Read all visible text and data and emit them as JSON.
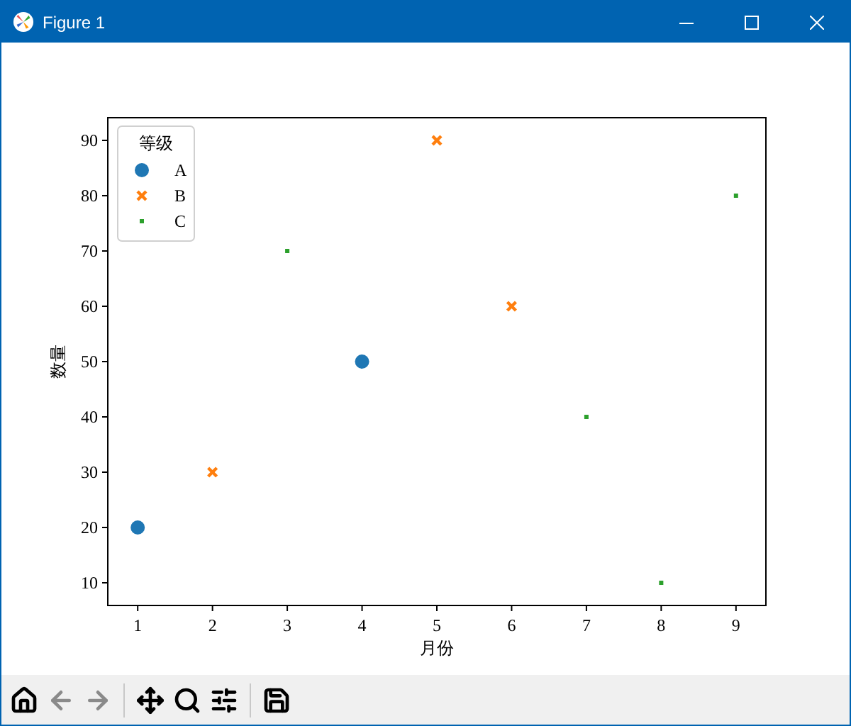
{
  "window": {
    "title": "Figure 1"
  },
  "figure": {
    "chart_data": {
      "type": "scatter",
      "legend": {
        "title": "等级"
      },
      "xlabel": "月份",
      "ylabel": "数量",
      "x": [
        1,
        2,
        3,
        4,
        5,
        6,
        7,
        8,
        9
      ],
      "series": [
        {
          "name": "A",
          "color": "#1f77b4",
          "marker": "circle",
          "values": [
            20,
            null,
            null,
            50,
            null,
            null,
            null,
            null,
            null
          ]
        },
        {
          "name": "B",
          "color": "#ff7f0e",
          "marker": "x",
          "values": [
            null,
            30,
            null,
            null,
            90,
            60,
            null,
            null,
            null
          ]
        },
        {
          "name": "C",
          "color": "#2ca02c",
          "marker": "square",
          "values": [
            null,
            null,
            70,
            null,
            null,
            null,
            40,
            10,
            80
          ]
        }
      ],
      "xlim": [
        0.6,
        9.4
      ],
      "ylim": [
        5.9,
        94.1
      ],
      "xticks": [
        1,
        2,
        3,
        4,
        5,
        6,
        7,
        8,
        9
      ],
      "yticks": [
        10,
        20,
        30,
        40,
        50,
        60,
        70,
        80,
        90
      ]
    }
  },
  "toolbar": {
    "buttons": [
      {
        "kind": "home",
        "disabled": false
      },
      {
        "kind": "back",
        "disabled": true
      },
      {
        "kind": "forward",
        "disabled": true
      },
      {
        "kind": "separator"
      },
      {
        "kind": "pan",
        "disabled": false
      },
      {
        "kind": "zoom",
        "disabled": false
      },
      {
        "kind": "configure",
        "disabled": false
      },
      {
        "kind": "separator"
      },
      {
        "kind": "save",
        "disabled": false
      }
    ]
  }
}
